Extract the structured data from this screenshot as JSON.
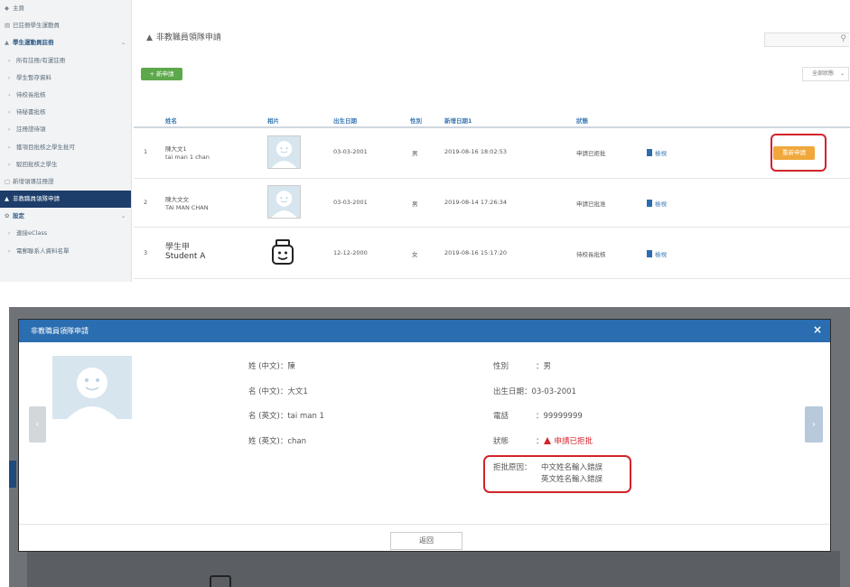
{
  "sidebar": {
    "items": [
      {
        "icon": "◆",
        "label": "主頁"
      },
      {
        "icon": "▤",
        "label": "已註冊學生運動員"
      },
      {
        "icon": "▲",
        "label": "學生運動員註冊"
      },
      {
        "icon": "›",
        "label": "所有註冊/有運註冊"
      },
      {
        "icon": "›",
        "label": "學生暫存資料"
      },
      {
        "icon": "›",
        "label": "待校長批核"
      },
      {
        "icon": "›",
        "label": "待秘書批核"
      },
      {
        "icon": "›",
        "label": "註冊證待領"
      },
      {
        "icon": "›",
        "label": "獲項目批核之學生批可"
      },
      {
        "icon": "›",
        "label": "駁回批核之學生"
      },
      {
        "icon": "▢",
        "label": "新增領導註冊證"
      },
      {
        "icon": "▲",
        "label": "非教職員領隊申請"
      },
      {
        "icon": "✿",
        "label": "設定"
      },
      {
        "icon": "›",
        "label": "連接eClass"
      },
      {
        "icon": "›",
        "label": "電郵聯系人資料名單"
      }
    ]
  },
  "main": {
    "title": "非教職員領隊申請",
    "new_button": "+ 新申請",
    "status_filter": "全部狀態",
    "columns": [
      "姓名",
      "相片",
      "出生日期",
      "性別",
      "新增日期1",
      "狀態"
    ],
    "rows": [
      {
        "no": "1",
        "name_cn": "陳大文1",
        "name_en": "tai man 1 chan",
        "dob": "03-03-2001",
        "gender": "男",
        "created": "2019-08-16 18:02:53",
        "status": "申請已拒批",
        "action": "檢視",
        "extra": "重新申請"
      },
      {
        "no": "2",
        "name_cn": "陳大文文",
        "name_en": "TAI MAN CHAN",
        "dob": "03-03-2001",
        "gender": "男",
        "created": "2019-08-14 17:26:34",
        "status": "申請已批准",
        "action": "檢視"
      },
      {
        "no": "3",
        "name_cn": "學生甲",
        "name_en": "Student A",
        "dob": "12-12-2000",
        "gender": "女",
        "created": "2019-08-16 15:17:20",
        "status": "待校長批核",
        "action": "檢視"
      }
    ]
  },
  "modal": {
    "title": "非教職員領隊申請",
    "close_icon": "×",
    "fields": {
      "surname_cn_label": "姓 (中文)：",
      "surname_cn": "陳",
      "given_cn_label": "名 (中文)：",
      "given_cn": "大文1",
      "given_en_label": "名 (英文)：",
      "given_en": "tai man 1",
      "surname_en_label": "姓 (英文)：",
      "surname_en": "chan",
      "gender_label": "性別",
      "gender": "：男",
      "dob_label": "出生日期：",
      "dob": "03-03-2001",
      "phone_label": "電話",
      "phone": "：99999999",
      "status_label": "狀態",
      "status_sep": "：",
      "status": "申請已拒批",
      "reason_label": "拒批原因：",
      "reason_line1": "中文姓名輸入錯誤",
      "reason_line2": "英文姓名輸入錯誤"
    },
    "close_button": "返回"
  },
  "colors": {
    "header_blue": "#2a6db0",
    "highlight_red": "#d3232a",
    "new_button_green": "#5da84b",
    "reapply_orange": "#f0a83c",
    "sidebar_active": "#1d3d6a"
  }
}
